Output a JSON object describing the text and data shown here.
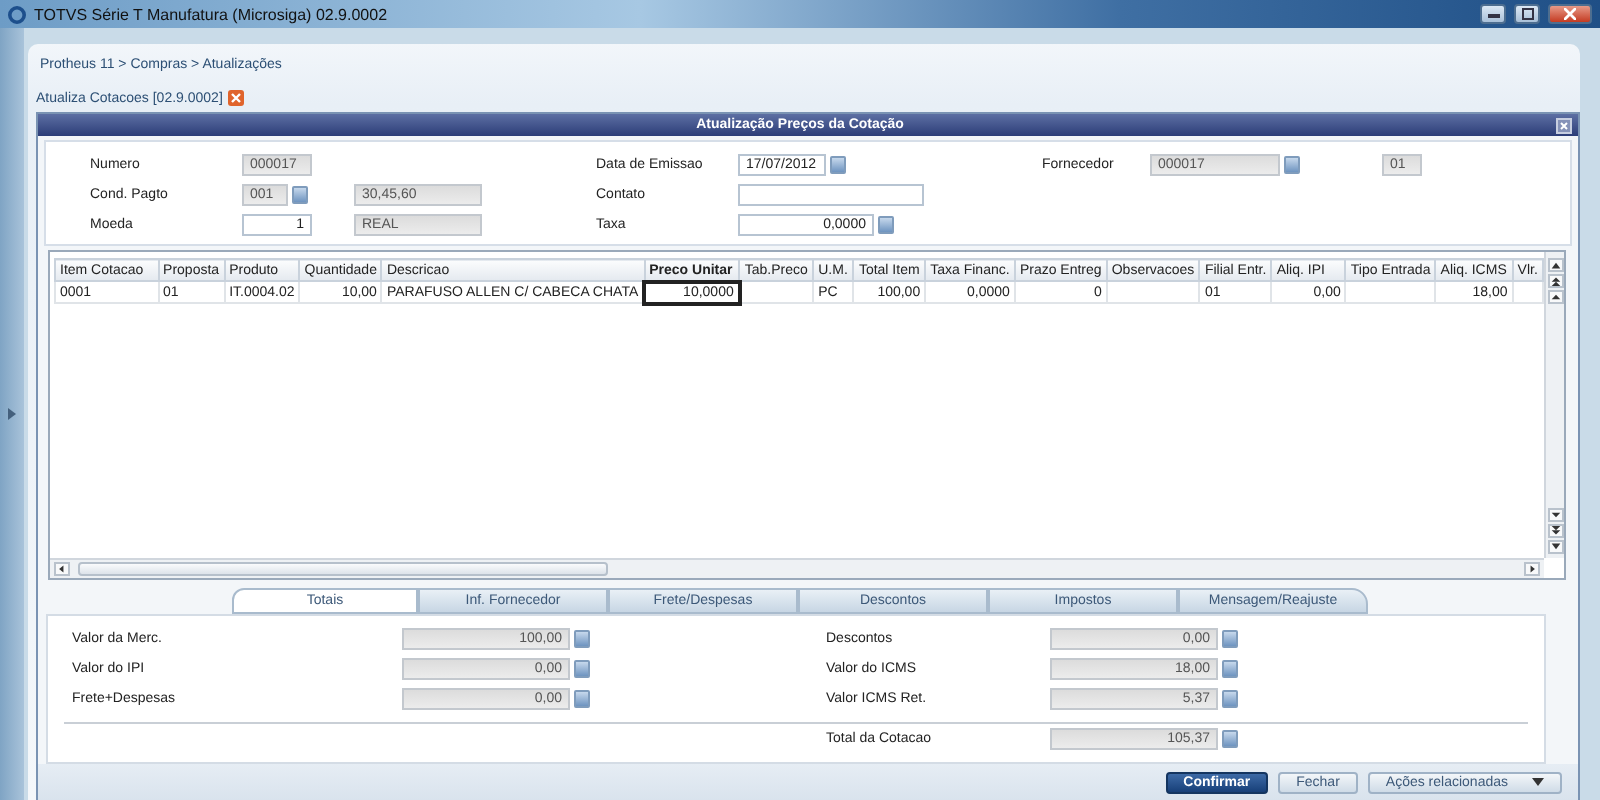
{
  "window": {
    "title": "TOTVS Série T Manufatura (Microsiga) 02.9.0002"
  },
  "breadcrumb": "Protheus 11 > Compras > Atualizações",
  "doc_tab": {
    "label": "Atualiza Cotacoes [02.9.0002]"
  },
  "dialog": {
    "title": "Atualização Preços da Cotação"
  },
  "form": {
    "rows": [
      {
        "groups": [
          {
            "label": "Numero",
            "fields": [
              {
                "value": "000017",
                "disabled": true,
                "lookup": false
              }
            ]
          },
          {
            "label": "Data de Emissao",
            "fields": [
              {
                "value": "17/07/2012",
                "disabled": false,
                "lookup": true
              }
            ]
          },
          {
            "label": "Fornecedor",
            "fields": [
              {
                "value": "000017",
                "disabled": true,
                "lookup": true
              },
              {
                "value": "01",
                "disabled": true,
                "lookup": false
              }
            ]
          }
        ]
      },
      {
        "groups": [
          {
            "label": "Cond. Pagto",
            "fields": [
              {
                "value": "001",
                "disabled": true,
                "lookup": true
              },
              {
                "value": "30,45,60",
                "disabled": true,
                "lookup": false
              }
            ]
          },
          {
            "label": "Contato",
            "fields": [
              {
                "disabled": false,
                "lookup": false
              }
            ]
          }
        ]
      },
      {
        "groups": [
          {
            "label": "Moeda",
            "fields": [
              {
                "value": "1",
                "disabled": false,
                "lookup": false
              },
              {
                "value": "REAL",
                "disabled": true,
                "lookup": false
              }
            ]
          },
          {
            "label": "Taxa",
            "fields": [
              {
                "value": "0,0000",
                "disabled": false,
                "lookup": true
              }
            ]
          }
        ]
      }
    ]
  },
  "grid": {
    "columns": [
      {
        "label": "Item Cotacao",
        "kind": "text",
        "selected": false
      },
      {
        "label": "Proposta",
        "kind": "text",
        "selected": false
      },
      {
        "label": "Produto",
        "kind": "text",
        "selected": false
      },
      {
        "label": "Quantidade",
        "kind": "number",
        "selected": false
      },
      {
        "label": "Descricao",
        "kind": "text",
        "selected": false
      },
      {
        "label": "Preco Unitar",
        "kind": "number",
        "selected": true
      },
      {
        "label": "Tab.Preco",
        "kind": "text",
        "selected": false
      },
      {
        "label": "U.M.",
        "kind": "text",
        "selected": false
      },
      {
        "label": "Total Item",
        "kind": "number",
        "selected": false
      },
      {
        "label": "Taxa Financ.",
        "kind": "number",
        "selected": false
      },
      {
        "label": "Prazo Entreg",
        "kind": "number",
        "selected": false
      },
      {
        "label": "Observacoes",
        "kind": "text",
        "selected": false
      },
      {
        "label": "Filial Entr.",
        "kind": "text",
        "selected": false
      },
      {
        "label": "Aliq. IPI",
        "kind": "number",
        "selected": false
      },
      {
        "label": "Tipo Entrada",
        "kind": "text",
        "selected": false
      },
      {
        "label": "Aliq. ICMS",
        "kind": "number",
        "selected": false
      },
      {
        "label": "Vlr.",
        "kind": "number",
        "selected": false
      }
    ],
    "rows": [
      {
        "cells": [
          "0001",
          "01",
          "IT.0004.02",
          "10,00",
          "PARAFUSO ALLEN C/ CABECA CHATA",
          "10,0000",
          "",
          "PC",
          "100,00",
          "0,0000",
          "0",
          "",
          "01",
          "0,00",
          "",
          "18,00",
          ""
        ]
      }
    ]
  },
  "tabs": [
    {
      "label": "Totais",
      "selected": true
    },
    {
      "label": "Inf. Fornecedor",
      "selected": false
    },
    {
      "label": "Frete/Despesas",
      "selected": false
    },
    {
      "label": "Descontos",
      "selected": false
    },
    {
      "label": "Impostos",
      "selected": false
    },
    {
      "label": "Mensagem/Reajuste",
      "selected": false
    }
  ],
  "totals": {
    "left": [
      {
        "label": "Valor da Merc.",
        "value": "100,00"
      },
      {
        "label": "Valor do IPI",
        "value": "0,00"
      },
      {
        "label": "Frete+Despesas",
        "value": "0,00"
      }
    ],
    "right": [
      {
        "label": "Descontos",
        "value": "0,00"
      },
      {
        "label": "Valor do ICMS",
        "value": "18,00"
      },
      {
        "label": "Valor ICMS Ret.",
        "value": "5,37"
      }
    ],
    "total": {
      "label": "Total da Cotacao",
      "value": "105,37"
    }
  },
  "buttons": [
    {
      "label": "Confirmar",
      "kind": "primary"
    },
    {
      "label": "Fechar",
      "kind": "default"
    },
    {
      "label": "Ações relacionadas",
      "kind": "menu"
    }
  ]
}
